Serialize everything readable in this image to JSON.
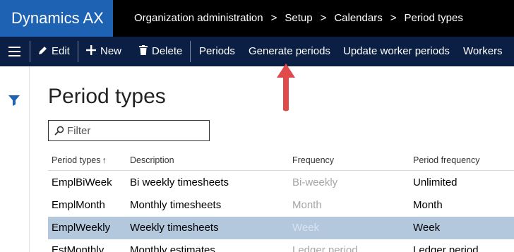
{
  "app": {
    "title": "Dynamics AX"
  },
  "breadcrumb": [
    "Organization administration",
    "Setup",
    "Calendars",
    "Period types"
  ],
  "breadcrumb_separator": ">",
  "actions": {
    "edit": "Edit",
    "new": "New",
    "delete": "Delete",
    "periods": "Periods",
    "generate_periods": "Generate periods",
    "update_worker_periods": "Update worker periods",
    "workers": "Workers"
  },
  "page": {
    "title": "Period types"
  },
  "filter": {
    "placeholder": "Filter",
    "value": ""
  },
  "grid": {
    "columns": [
      "Period types",
      "Description",
      "Frequency",
      "Period frequency"
    ],
    "sort_indicator": "↑",
    "rows": [
      {
        "period_type": "EmplBiWeek",
        "description": "Bi weekly timesheets",
        "frequency": "Bi-weekly",
        "period_frequency": "Unlimited",
        "selected": false
      },
      {
        "period_type": "EmplMonth",
        "description": "Monthly timesheets",
        "frequency": "Month",
        "period_frequency": "Month",
        "selected": false
      },
      {
        "period_type": "EmplWeekly",
        "description": "Weekly timesheets",
        "frequency": "Week",
        "period_frequency": "Week",
        "selected": true
      },
      {
        "period_type": "EstMonthly",
        "description": "Monthly estimates",
        "frequency": "Ledger period",
        "period_frequency": "Ledger period",
        "selected": false
      }
    ]
  },
  "colors": {
    "brand": "#1e63b3",
    "topbar": "#000000",
    "actionbar": "#0b1f44",
    "selected_row": "#b4c8dd",
    "annotation_arrow": "#e04a4a",
    "filter_icon": "#1e63b3"
  },
  "icons": {
    "menu": "hamburger-icon",
    "edit": "pencil-icon",
    "new": "plus-icon",
    "delete": "trash-icon",
    "filter_pane": "funnel-icon",
    "search": "magnifier-icon"
  }
}
